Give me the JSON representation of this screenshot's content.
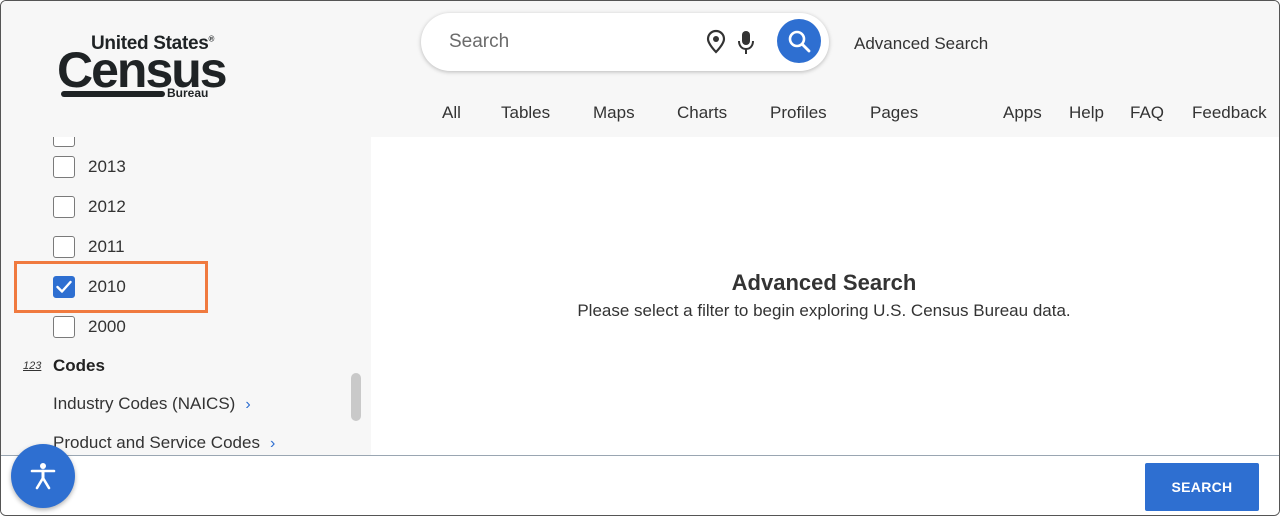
{
  "header": {
    "logo": {
      "line1": "United States",
      "reg": "®",
      "line2": "Census",
      "line3": "Bureau"
    },
    "search": {
      "placeholder": "Search",
      "icons": [
        "location-pin-icon",
        "microphone-icon",
        "search-icon"
      ]
    },
    "advanced_search_link": "Advanced Search",
    "nav_tabs": [
      "All",
      "Tables",
      "Maps",
      "Charts",
      "Profiles",
      "Pages"
    ],
    "nav_links": [
      "Apps",
      "Help",
      "FAQ",
      "Feedback"
    ]
  },
  "sidebar": {
    "years": [
      {
        "label": "2013",
        "checked": false
      },
      {
        "label": "2012",
        "checked": false
      },
      {
        "label": "2011",
        "checked": false
      },
      {
        "label": "2010",
        "checked": true
      },
      {
        "label": "2000",
        "checked": false
      }
    ],
    "codes_section": {
      "icon_text": "123",
      "title": "Codes",
      "items": [
        "Industry Codes (NAICS)",
        "Product and Service Codes"
      ]
    }
  },
  "main": {
    "title": "Advanced Search",
    "subtitle": "Please select a filter to begin exploring U.S. Census Bureau data."
  },
  "footer": {
    "search_button": "SEARCH",
    "accessibility_icon": "accessibility-icon"
  },
  "colors": {
    "accent": "#2e6fd1",
    "highlight": "#f07a3f",
    "header_bg": "#f7f7f7"
  }
}
